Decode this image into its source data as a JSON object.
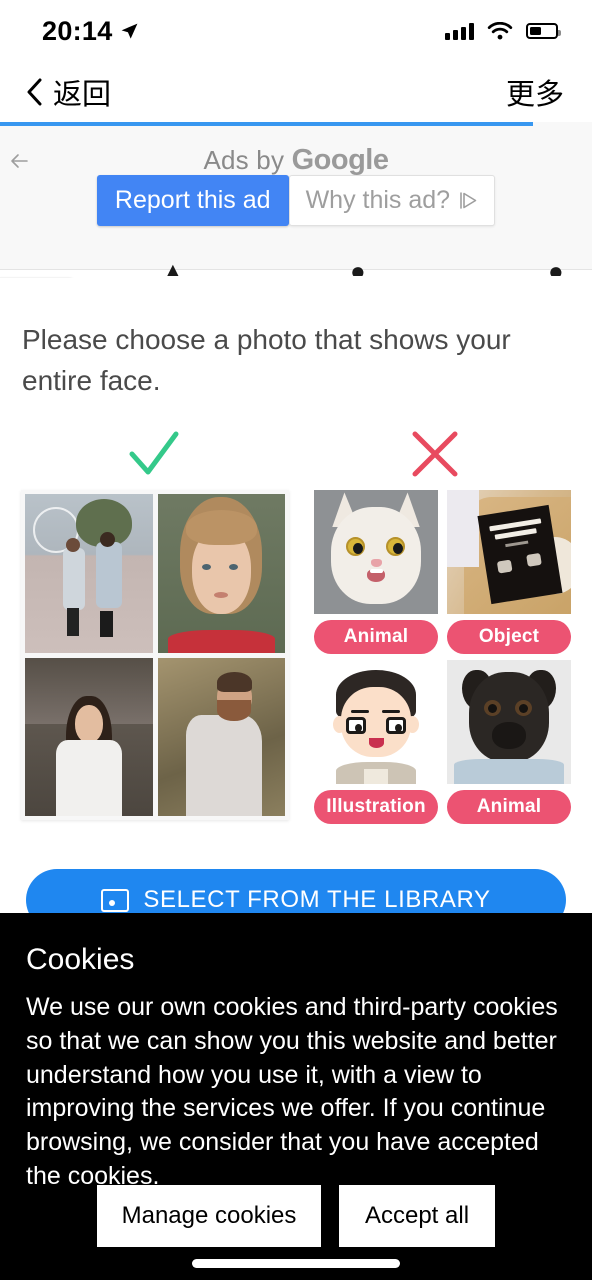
{
  "status_bar": {
    "time": "20:14",
    "location_icon": "location-arrow-icon",
    "signal_icon": "cellular-signal-icon",
    "wifi_icon": "wifi-icon",
    "battery_icon": "battery-icon",
    "battery_level": "45%"
  },
  "nav_bar": {
    "back_label": "返回",
    "back_icon": "chevron-left-icon",
    "more_label": "更多"
  },
  "ad": {
    "back_icon": "arrow-left-icon",
    "ads_by": "Ads by",
    "brand": "Google",
    "report_label": "Report this ad",
    "why_label": "Why this ad?",
    "why_icon": "ad-choices-triangle-icon",
    "progress_percent": "90",
    "accent_blue": "#4285f4",
    "progress_blue": "#3897f0"
  },
  "sheet": {
    "collapse_icon": "chevron-up-icon",
    "instruction": "Please choose a photo that shows your entire face.",
    "check_icon": "check-mark-icon",
    "check_color": "#34c98a",
    "cross_icon": "cross-mark-icon",
    "cross_color": "#e84a5f",
    "pill_color": "#ec5372",
    "good_examples": [
      {
        "name": "couple-at-fair-photo"
      },
      {
        "name": "girl-portrait-photo"
      },
      {
        "name": "woman-in-white-coat-photo"
      },
      {
        "name": "bearded-man-photo"
      }
    ],
    "bad_examples": [
      {
        "name": "white-cat-photo",
        "label": "Animal"
      },
      {
        "name": "milk-and-honey-book-photo",
        "label": "Object"
      },
      {
        "name": "boy-illustration",
        "label": "Illustration"
      },
      {
        "name": "pug-dog-photo",
        "label": "Animal"
      }
    ],
    "book_cover": {
      "line1": "milk and",
      "line2": "honey",
      "line3": "rupi kaur"
    }
  },
  "cta": {
    "label": "SELECT FROM THE LIBRARY",
    "icon": "photo-library-icon",
    "color": "#1f87f0"
  },
  "cookies": {
    "title": "Cookies",
    "body": "We use our own cookies and third-party cookies so that we can show you this website and better understand how you use it, with a view to improving the services we offer. If you continue browsing, we consider that you have accepted the cookies.",
    "manage_label": "Manage cookies",
    "accept_label": "Accept all"
  }
}
